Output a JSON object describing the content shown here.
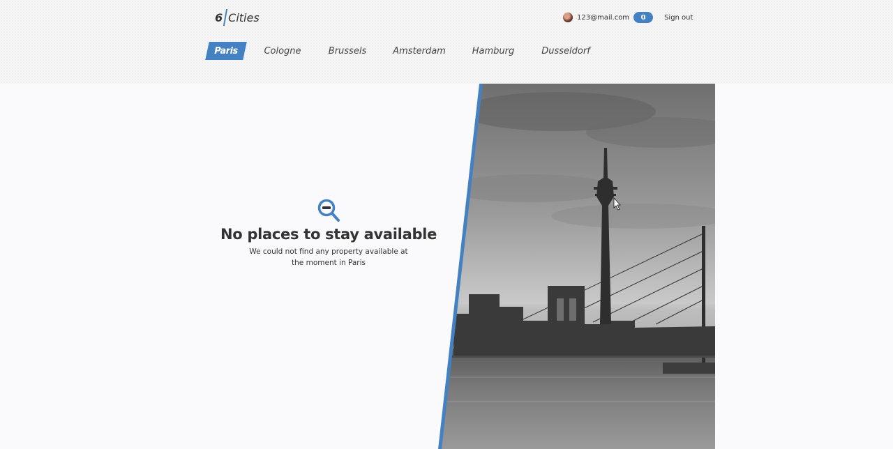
{
  "logo": {
    "number": "6",
    "word": "Cities"
  },
  "user": {
    "email": "123@mail.com",
    "favorites_count": "0",
    "signout_label": "Sign out"
  },
  "cities": [
    {
      "label": "Paris",
      "active": true
    },
    {
      "label": "Cologne",
      "active": false
    },
    {
      "label": "Brussels",
      "active": false
    },
    {
      "label": "Amsterdam",
      "active": false
    },
    {
      "label": "Hamburg",
      "active": false
    },
    {
      "label": "Dusseldorf",
      "active": false
    }
  ],
  "empty_state": {
    "title": "No places to stay available",
    "description": "We could not find any property available at the moment in Paris",
    "icon": "search-minus-icon"
  },
  "colors": {
    "accent": "#4481c3",
    "text": "#333333"
  }
}
